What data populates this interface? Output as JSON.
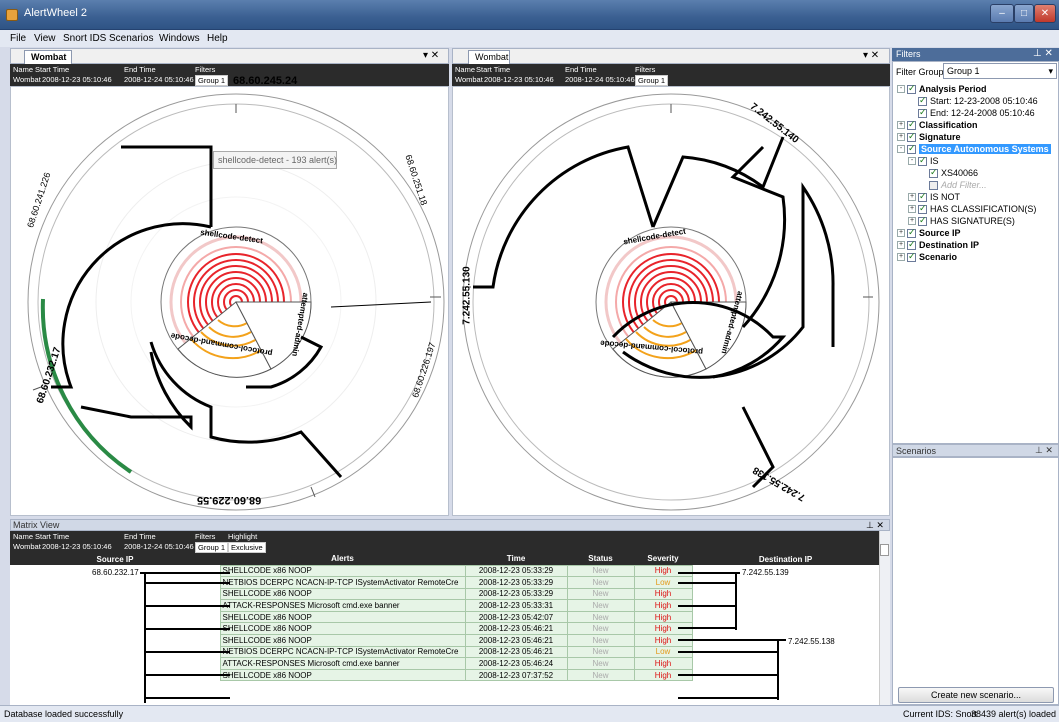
{
  "window": {
    "title": "AlertWheel 2"
  },
  "menu": [
    "File",
    "View",
    "Snort IDS",
    "Scenarios",
    "Windows",
    "Help"
  ],
  "panes": [
    {
      "tab": "Wombat",
      "labels": {
        "name": "Name",
        "start": "Start Time",
        "end": "End Time",
        "filters": "Filters"
      },
      "name": "Wombat",
      "start": "2008-12-23 05:10:46",
      "end": "2008-12-24 05:10:46",
      "filter": "Group 1",
      "outer_labels": [
        "68.60.245.24",
        "68.60.251.18",
        "68.60.226.197",
        "68.60.229.55",
        "68.60.232.17",
        "68.60.241.226"
      ],
      "inner_labels": [
        "shellcode-detect",
        "protocol-command-decode",
        "attempted-admin"
      ],
      "tooltip": "shellcode-detect - 193 alert(s)"
    },
    {
      "tab": "Wombat",
      "labels": {
        "name": "Name",
        "start": "Start Time",
        "end": "End Time",
        "filters": "Filters"
      },
      "name": "Wombat",
      "start": "2008-12-23 05:10:46",
      "end": "2008-12-24 05:10:46",
      "filter": "Group 1",
      "outer_labels": [
        "7.242.55.140",
        "7.242.55.130",
        "7.242.55.138"
      ],
      "inner_labels": [
        "shellcode-detect",
        "protocol-command-decode",
        "attempted-admin"
      ]
    }
  ],
  "filters": {
    "title": "Filters",
    "group_label": "Filter Group:",
    "group_value": "Group 1",
    "tree": [
      {
        "label": "Analysis Period",
        "level": 0,
        "bold": true,
        "exp": "-"
      },
      {
        "label": "Start: 12-23-2008 05:10:46",
        "level": 1
      },
      {
        "label": "End: 12-24-2008 05:10:46",
        "level": 1
      },
      {
        "label": "Classification",
        "level": 0,
        "bold": true,
        "exp": "+"
      },
      {
        "label": "Signature",
        "level": 0,
        "bold": true,
        "exp": "+"
      },
      {
        "label": "Source Autonomous Systems",
        "level": 0,
        "bold": true,
        "exp": "-",
        "selected": true
      },
      {
        "label": "IS",
        "level": 1,
        "exp": "-"
      },
      {
        "label": "XS40066",
        "level": 2
      },
      {
        "label": "Add Filter...",
        "level": 2,
        "placeholder": true
      },
      {
        "label": "IS NOT",
        "level": 1,
        "exp": "+"
      },
      {
        "label": "HAS CLASSIFICATION(S)",
        "level": 1,
        "exp": "+"
      },
      {
        "label": "HAS SIGNATURE(S)",
        "level": 1,
        "exp": "+"
      },
      {
        "label": "Source IP",
        "level": 0,
        "bold": true,
        "exp": "+"
      },
      {
        "label": "Destination IP",
        "level": 0,
        "bold": true,
        "exp": "+"
      },
      {
        "label": "Scenario",
        "level": 0,
        "bold": true,
        "exp": "+"
      }
    ]
  },
  "scenarios": {
    "title": "Scenarios",
    "button": "Create new scenario..."
  },
  "matrix": {
    "title": "Matrix View",
    "labels": {
      "name": "Name",
      "start": "Start Time",
      "end": "End Time",
      "filters": "Filters",
      "highlight": "Highlight"
    },
    "name": "Wombat",
    "start": "2008-12-23 05:10:46",
    "end": "2008-12-24 05:10:46",
    "filter": "Group 1",
    "highlight": "Exclusive",
    "columns": [
      "Source IP",
      "Alerts",
      "Time",
      "Status",
      "Severity",
      "Destination IP"
    ],
    "source_ip": "68.60.232.17",
    "dest_ips": [
      "7.242.55.139",
      "7.242.55.138"
    ],
    "rows": [
      {
        "alert": "SHELLCODE x86 NOOP",
        "time": "2008-12-23 05:33:29",
        "status": "New",
        "severity": "High"
      },
      {
        "alert": "NETBIOS DCERPC NCACN-IP-TCP ISystemActivator RemoteCre",
        "time": "2008-12-23 05:33:29",
        "status": "New",
        "severity": "Low"
      },
      {
        "alert": "SHELLCODE x86 NOOP",
        "time": "2008-12-23 05:33:29",
        "status": "New",
        "severity": "High"
      },
      {
        "alert": "ATTACK-RESPONSES Microsoft cmd.exe banner",
        "time": "2008-12-23 05:33:31",
        "status": "New",
        "severity": "High"
      },
      {
        "alert": "SHELLCODE x86 NOOP",
        "time": "2008-12-23 05:42:07",
        "status": "New",
        "severity": "High"
      },
      {
        "alert": "SHELLCODE x86 NOOP",
        "time": "2008-12-23 05:46:21",
        "status": "New",
        "severity": "High"
      },
      {
        "alert": "SHELLCODE x86 NOOP",
        "time": "2008-12-23 05:46:21",
        "status": "New",
        "severity": "High"
      },
      {
        "alert": "NETBIOS DCERPC NCACN-IP-TCP ISystemActivator RemoteCre",
        "time": "2008-12-23 05:46:21",
        "status": "New",
        "severity": "Low"
      },
      {
        "alert": "ATTACK-RESPONSES Microsoft cmd.exe banner",
        "time": "2008-12-23 05:46:24",
        "status": "New",
        "severity": "High"
      },
      {
        "alert": "SHELLCODE x86 NOOP",
        "time": "2008-12-23 07:37:52",
        "status": "New",
        "severity": "High"
      }
    ]
  },
  "status": {
    "left": "Database loaded successfully",
    "ids": "Current IDS: Snort",
    "count": "38439 alert(s) loaded"
  },
  "colors": {
    "accent": "#3399ff",
    "high": "#dd1111",
    "low": "#e39a19",
    "ring_red": "#e8242b",
    "ring_orange": "#f3a21b",
    "green": "#2a8a45"
  }
}
